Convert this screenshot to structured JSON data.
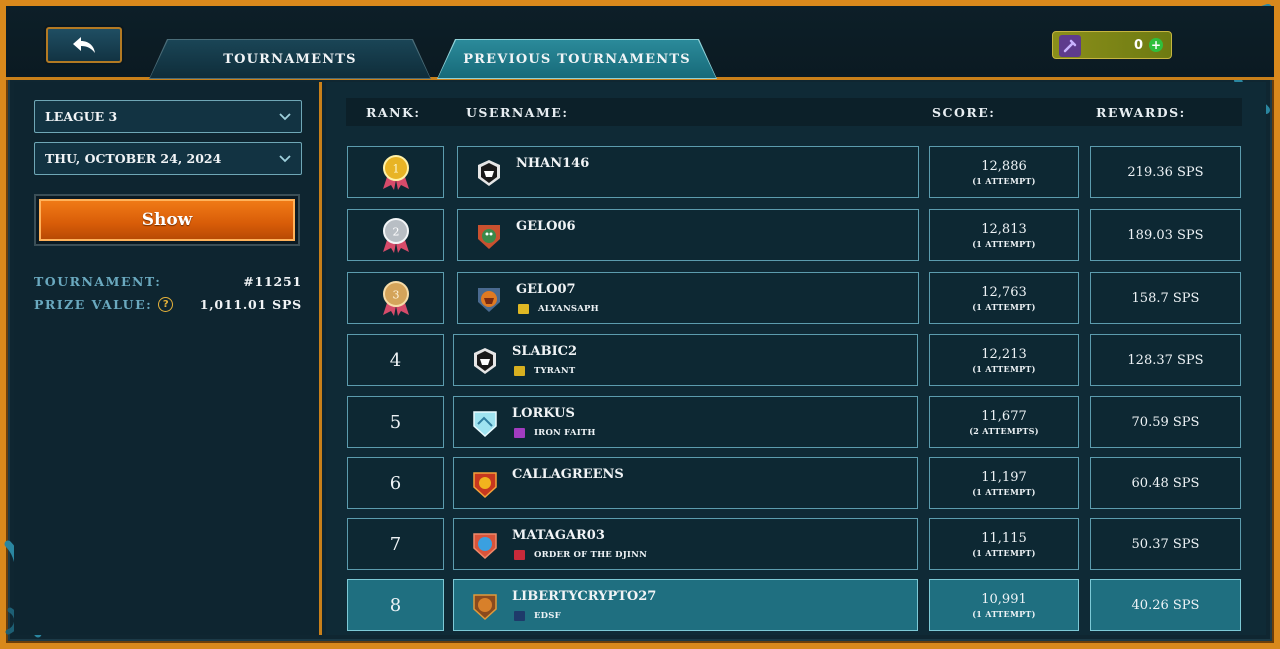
{
  "header": {
    "tabs": [
      {
        "label": "TOURNAMENTS",
        "active": false
      },
      {
        "label": "PREVIOUS TOURNAMENTS",
        "active": true
      }
    ],
    "currency": {
      "value": "0",
      "icon": "potion-icon"
    }
  },
  "sidebar": {
    "league_select": "LEAGUE 3",
    "date_select": "THU, OCTOBER 24, 2024",
    "show_button": "Show",
    "tournament_label": "TOURNAMENT:",
    "tournament_value": "#11251",
    "prize_label": "PRIZE VALUE:",
    "prize_value": "1,011.01 SPS"
  },
  "table": {
    "headers": {
      "rank": "RANK:",
      "username": "USERNAME:",
      "score": "SCORE:",
      "rewards": "REWARDS:"
    },
    "rows": [
      {
        "rank": "1",
        "medal": "gold",
        "username": "NHAN146",
        "guild": "",
        "score": "12,886",
        "attempts": "(1 ATTEMPT)",
        "reward": "219.36 SPS"
      },
      {
        "rank": "2",
        "medal": "silver",
        "username": "GELO06",
        "guild": "",
        "score": "12,813",
        "attempts": "(1 ATTEMPT)",
        "reward": "189.03 SPS"
      },
      {
        "rank": "3",
        "medal": "bronze",
        "username": "GELO07",
        "guild": "ALYANSAPH",
        "score": "12,763",
        "attempts": "(1 ATTEMPT)",
        "reward": "158.7 SPS"
      },
      {
        "rank": "4",
        "medal": "",
        "username": "SLABIC2",
        "guild": "TYRANT",
        "score": "12,213",
        "attempts": "(1 ATTEMPT)",
        "reward": "128.37 SPS"
      },
      {
        "rank": "5",
        "medal": "",
        "username": "LORKUS",
        "guild": "IRON FAITH",
        "score": "11,677",
        "attempts": "(2 ATTEMPTS)",
        "reward": "70.59 SPS"
      },
      {
        "rank": "6",
        "medal": "",
        "username": "CALLAGREENS",
        "guild": "",
        "score": "11,197",
        "attempts": "(1 ATTEMPT)",
        "reward": "60.48 SPS"
      },
      {
        "rank": "7",
        "medal": "",
        "username": "MATAGAR03",
        "guild": "ORDER OF THE DJINN",
        "score": "11,115",
        "attempts": "(1 ATTEMPT)",
        "reward": "50.37 SPS"
      },
      {
        "rank": "8",
        "medal": "",
        "username": "LIBERTYCRYPTO27",
        "guild": "EDSF",
        "score": "10,991",
        "attempts": "(1 ATTEMPT)",
        "reward": "40.26 SPS",
        "highlight": true
      }
    ]
  },
  "colors": {
    "frame_gold": "#d9891c",
    "panel": "#0f2a36",
    "cell_border": "#5c9cae",
    "highlight": "#1f6f80",
    "show_button": "#e06a0e"
  }
}
